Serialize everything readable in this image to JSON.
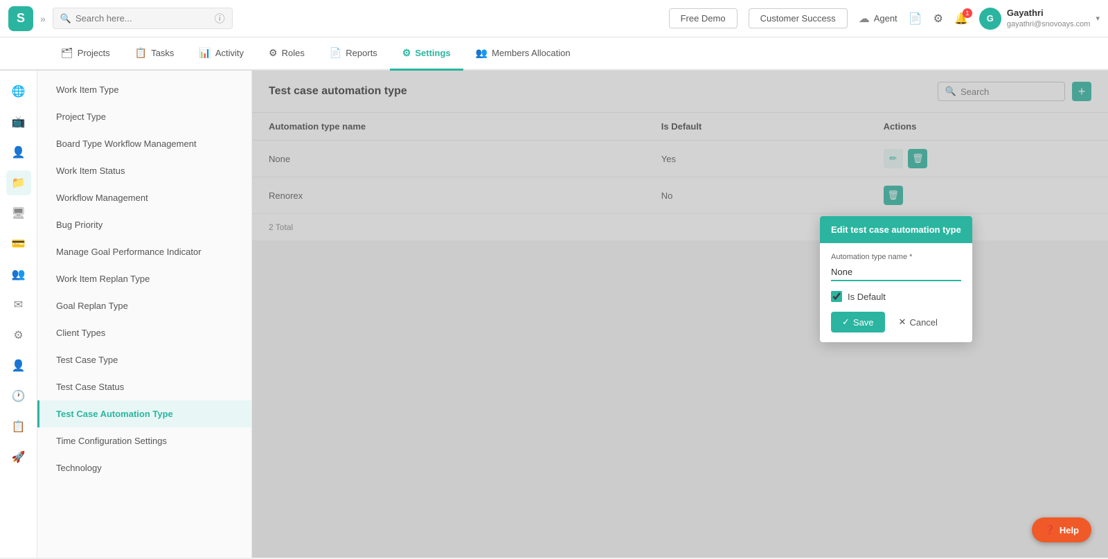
{
  "app": {
    "logo": "S",
    "search_placeholder": "Search here...",
    "free_demo_label": "Free Demo",
    "customer_success_label": "Customer Success",
    "agent_label": "Agent",
    "notification_count": "1",
    "user": {
      "name": "Gayathri",
      "email": "gayathri@snovoays.com"
    }
  },
  "nav_tabs": [
    {
      "label": "Projects",
      "icon": "🗂",
      "active": false
    },
    {
      "label": "Tasks",
      "icon": "📋",
      "active": false
    },
    {
      "label": "Activity",
      "icon": "📊",
      "active": false
    },
    {
      "label": "Roles",
      "icon": "⚙",
      "active": false
    },
    {
      "label": "Reports",
      "icon": "📄",
      "active": false
    },
    {
      "label": "Settings",
      "icon": "⚙",
      "active": true
    },
    {
      "label": "Members Allocation",
      "icon": "👥",
      "active": false
    }
  ],
  "icon_sidebar": [
    "🌐",
    "📺",
    "👤",
    "📁",
    "🖥",
    "💳",
    "👥",
    "✉",
    "⚙",
    "👤",
    "🕐",
    "📋",
    "🚀"
  ],
  "settings_sidebar": {
    "items": [
      {
        "label": "Work Item Type",
        "active": false
      },
      {
        "label": "Project Type",
        "active": false
      },
      {
        "label": "Board Type Workflow Management",
        "active": false
      },
      {
        "label": "Work Item Status",
        "active": false
      },
      {
        "label": "Workflow Management",
        "active": false
      },
      {
        "label": "Bug Priority",
        "active": false
      },
      {
        "label": "Manage Goal Performance Indicator",
        "active": false
      },
      {
        "label": "Work Item Replan Type",
        "active": false
      },
      {
        "label": "Goal Replan Type",
        "active": false
      },
      {
        "label": "Client Types",
        "active": false
      },
      {
        "label": "Test Case Type",
        "active": false
      },
      {
        "label": "Test Case Status",
        "active": false
      },
      {
        "label": "Test Case Automation Type",
        "active": true
      },
      {
        "label": "Time Configuration Settings",
        "active": false
      },
      {
        "label": "Technology",
        "active": false
      }
    ]
  },
  "content": {
    "title": "Test case automation type",
    "search_placeholder": "Search",
    "add_button_label": "+",
    "table": {
      "columns": [
        "Automation type name",
        "Is Default",
        "Actions"
      ],
      "rows": [
        {
          "name": "None",
          "is_default": "Yes"
        },
        {
          "name": "Renorex",
          "is_default": "No"
        }
      ]
    },
    "footer": "2 Total"
  },
  "modal": {
    "title": "Edit test case automation type",
    "field_label": "Automation type name *",
    "field_value": "None",
    "is_default_label": "Is Default",
    "is_default_checked": true,
    "save_label": "Save",
    "cancel_label": "Cancel"
  },
  "help_button": {
    "label": "Help",
    "icon": "?"
  }
}
